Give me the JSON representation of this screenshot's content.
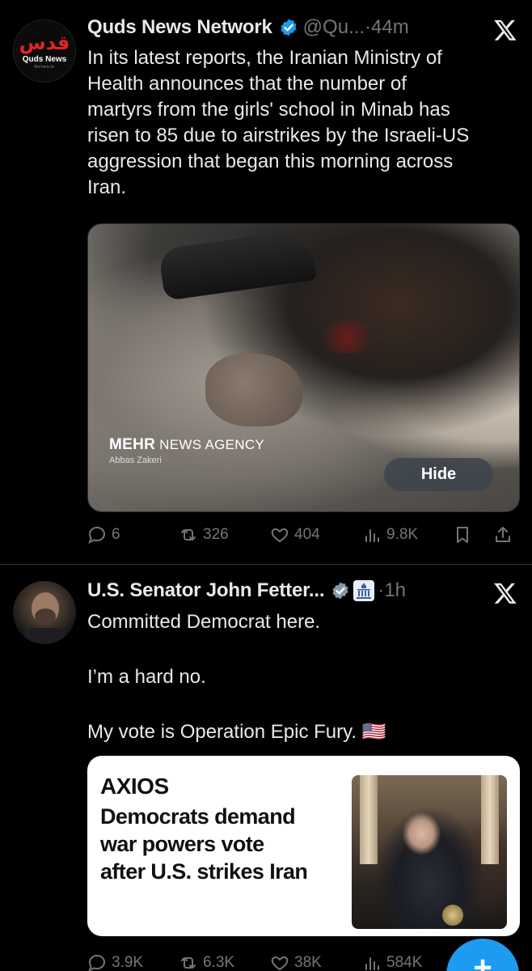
{
  "tweets": [
    {
      "avatar": {
        "arabic": "قدس",
        "name": "Quds News",
        "sub": "Network"
      },
      "name": "Quds News Network",
      "handle": "@Qu...",
      "dot": "·",
      "time": "44m",
      "text_lines": [
        "In its latest reports, the Iranian Ministry of",
        "Health announces that the number of",
        "martyrs from the girls' school in Minab has",
        "risen to 85 due to airstrikes by the Israeli-US",
        "aggression that began this morning across",
        "Iran."
      ],
      "media": {
        "watermark_brand": "MEHR",
        "watermark_rest": " NEWS AGENCY",
        "watermark_credit": "Abbas Zakeri",
        "hide_label": "Hide"
      },
      "stats": {
        "replies": "6",
        "reposts": "326",
        "likes": "404",
        "views": "9.8K"
      }
    },
    {
      "name": "U.S. Senator John Fetter...",
      "dot": "·",
      "time": "1h",
      "text_lines": [
        "Committed Democrat here.",
        "",
        "I’m a hard no.",
        "",
        "My vote is Operation Epic Fury. 🇺🇸"
      ],
      "card": {
        "logo": "AXIOS",
        "headline_lines": [
          "Democrats demand",
          "war powers vote",
          "after U.S. strikes Iran"
        ]
      },
      "stats": {
        "replies": "3.9K",
        "reposts": "6.3K",
        "likes": "38K",
        "views": "584K"
      }
    }
  ],
  "fab_label": "+",
  "colors": {
    "background": "#000000",
    "text": "#e7e9ea",
    "muted": "#71767b",
    "verified": "#1d9bf0",
    "fab": "#1d9bf0"
  }
}
